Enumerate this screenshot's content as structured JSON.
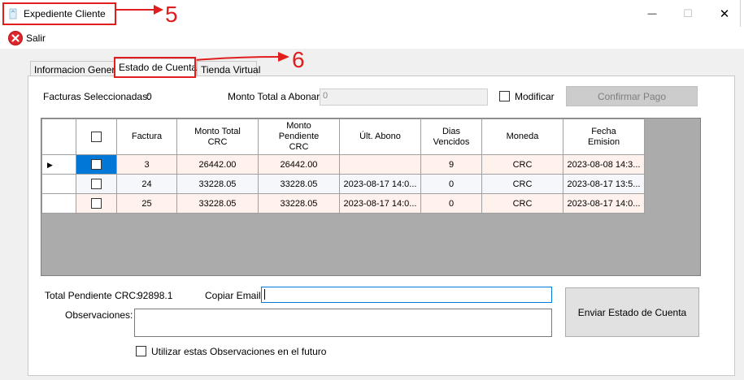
{
  "window": {
    "title": "Expediente Cliente",
    "minimize_glyph": "—",
    "maximize_glyph": "☐",
    "close_glyph": "✕"
  },
  "annotations": {
    "title_number": "5",
    "tab_number": "6",
    "color": "#e01e1e"
  },
  "toolbar": {
    "exit_label": "Salir",
    "exit_icon": "close-circle-icon"
  },
  "tabs": [
    {
      "label": "Informacion General"
    },
    {
      "label": "Estado de Cuenta"
    },
    {
      "label": "Tienda Virtual"
    }
  ],
  "summary": {
    "selected_label": "Facturas Seleccionadas:",
    "selected_value": "0",
    "total_pay_label": "Monto Total a Abonar:",
    "total_pay_value": "0",
    "modify_label": "Modificar",
    "confirm_label": "Confirmar Pago"
  },
  "grid": {
    "headers": [
      "",
      "Factura",
      "Monto Total\nCRC",
      "Monto\nPendiente\nCRC",
      "Últ. Abono",
      "Dias\nVencidos",
      "Moneda",
      "Fecha\nEmision"
    ],
    "rows": [
      {
        "factura": "3",
        "total": "26442.00",
        "pendiente": "26442.00",
        "abono": "",
        "dias": "9",
        "moneda": "CRC",
        "fecha": "2023-08-08 14:3..."
      },
      {
        "factura": "24",
        "total": "33228.05",
        "pendiente": "33228.05",
        "abono": "2023-08-17 14:0...",
        "dias": "0",
        "moneda": "CRC",
        "fecha": "2023-08-17 13:5..."
      },
      {
        "factura": "25",
        "total": "33228.05",
        "pendiente": "33228.05",
        "abono": "2023-08-17 14:0...",
        "dias": "0",
        "moneda": "CRC",
        "fecha": "2023-08-17 14:0..."
      }
    ]
  },
  "footer": {
    "pending_label": "Total Pendiente CRC:",
    "pending_value": "92898.1",
    "email_label": "Copiar Email:",
    "email_value": "",
    "obs_label": "Observaciones:",
    "obs_value": "",
    "send_label": "Enviar Estado de Cuenta",
    "future_label": "Utilizar estas Observaciones en el futuro"
  }
}
